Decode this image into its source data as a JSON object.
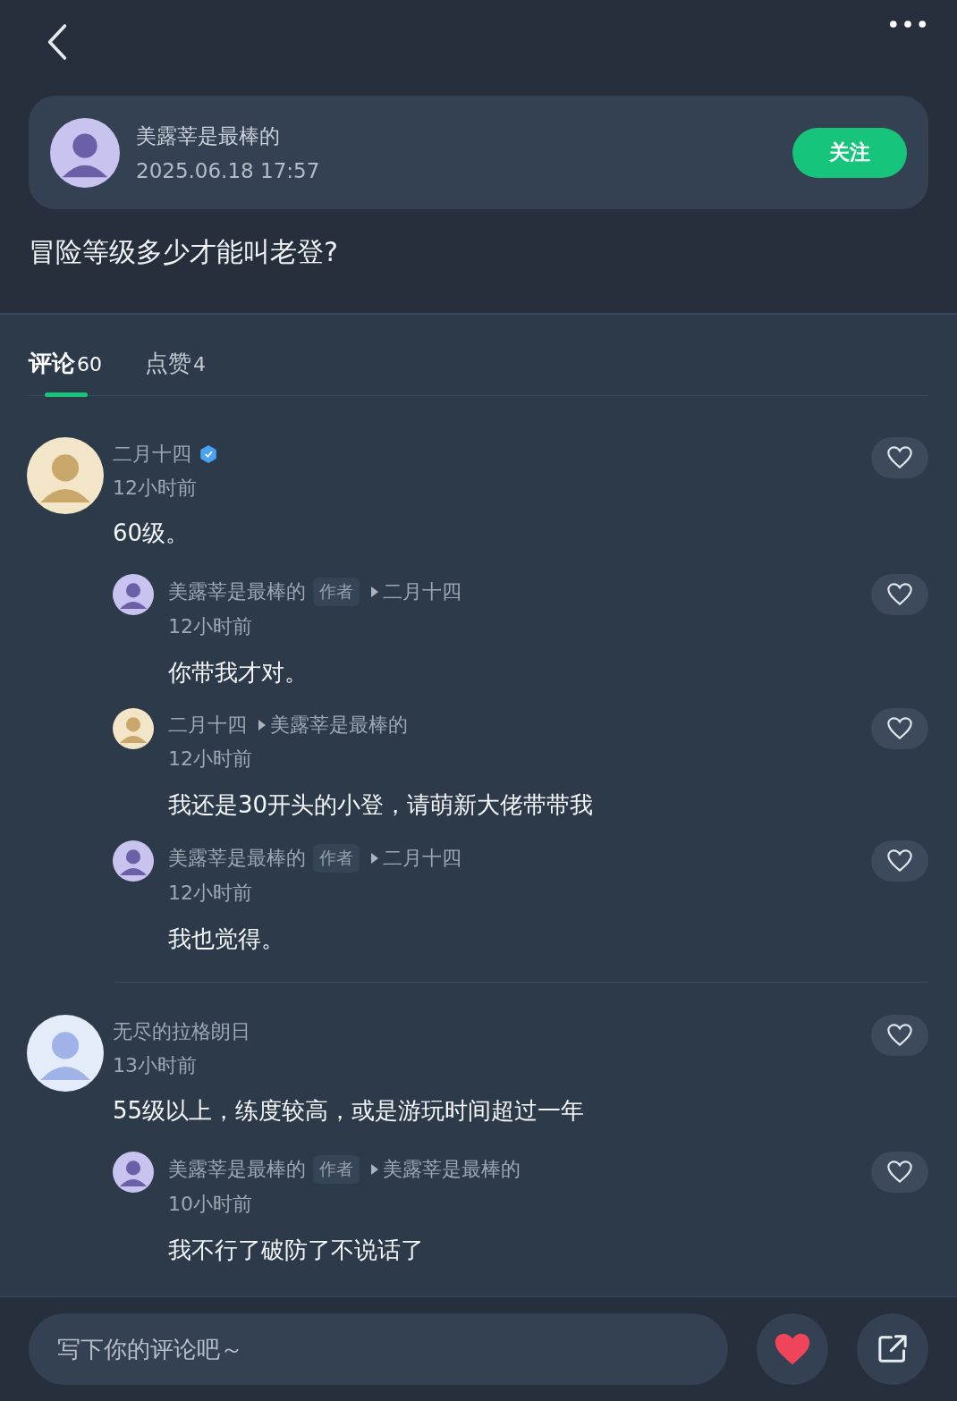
{
  "post": {
    "author": "美露莘是最棒的",
    "time": "2025.06.18 17:57",
    "follow_label": "关注",
    "title": "冒险等级多少才能叫老登?"
  },
  "tabs": [
    {
      "label": "评论",
      "count": "60",
      "selected": true
    },
    {
      "label": "点赞",
      "count": "4",
      "selected": false
    }
  ],
  "comments": [
    {
      "author": "二月十四",
      "verified": true,
      "time": "12小时前",
      "text": "60级。",
      "liked": false,
      "replies": [
        {
          "author": "美露莘是最棒的",
          "badge": "作者",
          "reply_to": "二月十四",
          "time": "12小时前",
          "text": "你带我才对。",
          "liked": false
        },
        {
          "author": "二月十四",
          "reply_to": "美露莘是最棒的",
          "time": "12小时前",
          "text": "我还是30开头的小登，请萌新大佬带带我",
          "liked": false
        },
        {
          "author": "美露莘是最棒的",
          "badge": "作者",
          "reply_to": "二月十四",
          "time": "12小时前",
          "text": "我也觉得。",
          "liked": false
        }
      ]
    },
    {
      "author": "无尽的拉格朗日",
      "verified": false,
      "time": "13小时前",
      "text": "55级以上，练度较高，或是游玩时间超过一年",
      "liked": false,
      "replies": [
        {
          "author": "美露莘是最棒的",
          "badge": "作者",
          "reply_to": "美露莘是最棒的",
          "time": "10小时前",
          "text": "我不行了破防了不说话了",
          "liked": false
        }
      ]
    }
  ],
  "composer": {
    "placeholder": "写下你的评论吧～",
    "liked": true
  }
}
